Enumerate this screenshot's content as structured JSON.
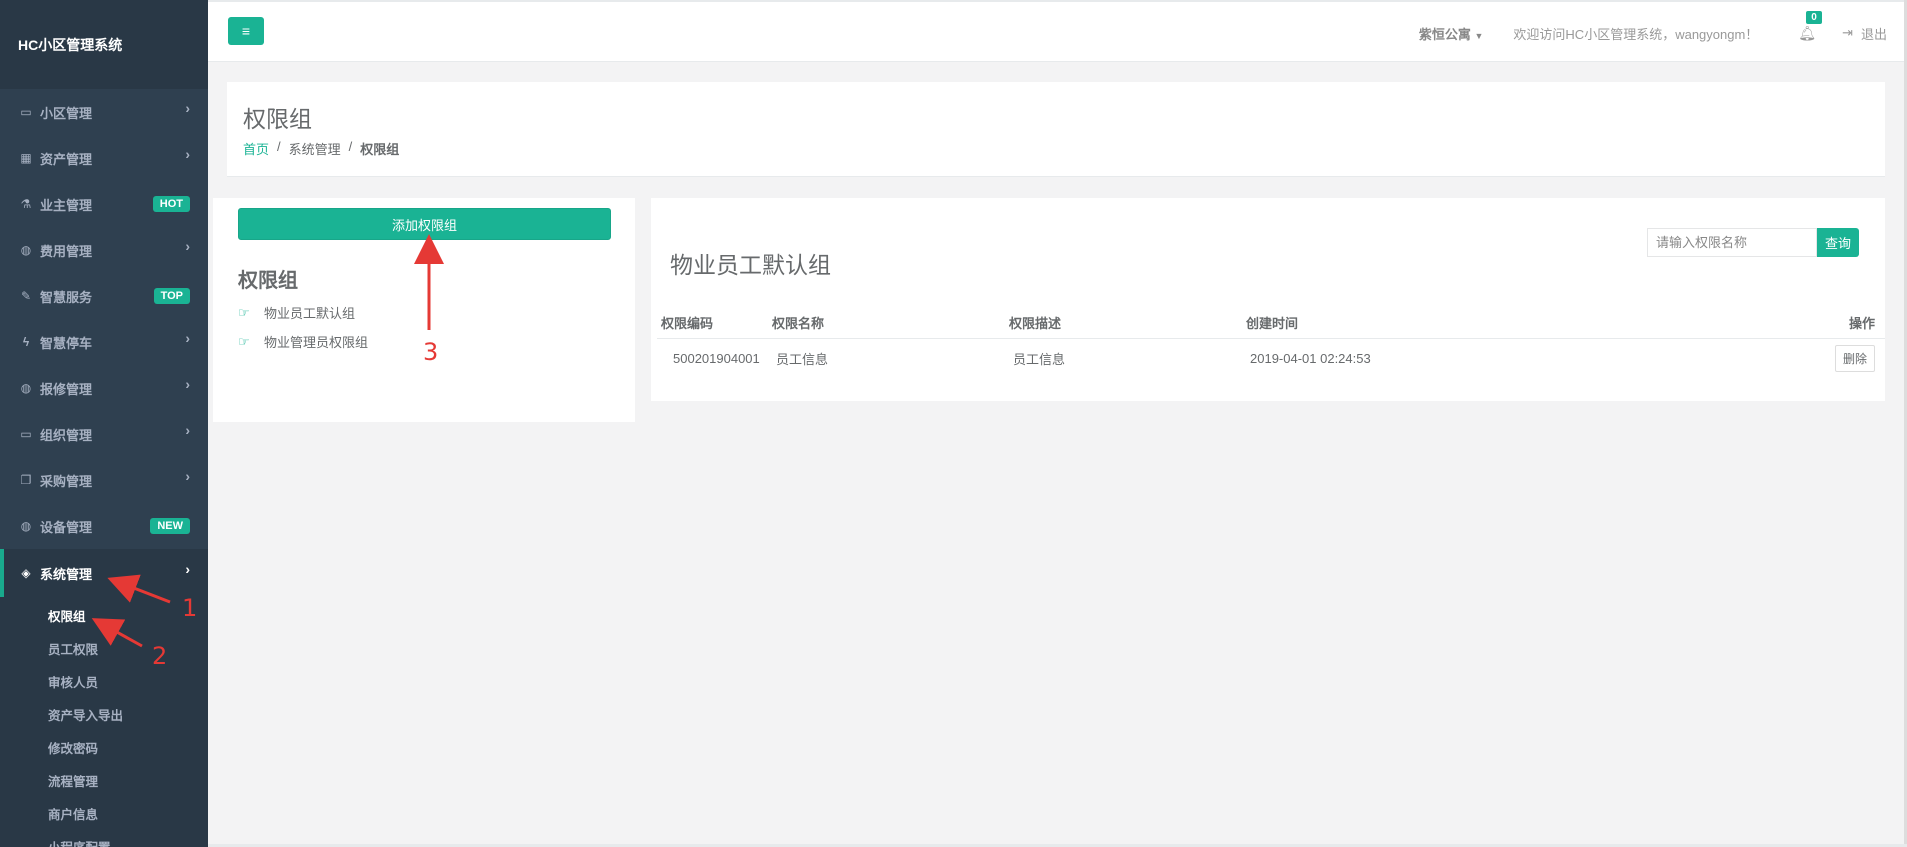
{
  "brand": "HC小区管理系统",
  "sidebar": {
    "items": [
      {
        "label": "小区管理",
        "icon": "laptop-icon",
        "glyph": "▭"
      },
      {
        "label": "资产管理",
        "icon": "grid-icon",
        "glyph": "▦"
      },
      {
        "label": "业主管理",
        "icon": "flask-icon",
        "glyph": "⚗",
        "badge": "HOT"
      },
      {
        "label": "费用管理",
        "icon": "globe-icon",
        "glyph": "◍"
      },
      {
        "label": "智慧服务",
        "icon": "edit-icon",
        "glyph": "✎",
        "badge": "TOP"
      },
      {
        "label": "智慧停车",
        "icon": "bolt-icon",
        "glyph": "ϟ"
      },
      {
        "label": "报修管理",
        "icon": "globe-icon",
        "glyph": "◍"
      },
      {
        "label": "组织管理",
        "icon": "desktop-icon",
        "glyph": "▭"
      },
      {
        "label": "采购管理",
        "icon": "copy-icon",
        "glyph": "❐"
      },
      {
        "label": "设备管理",
        "icon": "globe-icon",
        "glyph": "◍",
        "badge": "NEW"
      },
      {
        "label": "系统管理",
        "icon": "diamond-icon",
        "glyph": "◈"
      }
    ],
    "submenu": [
      "权限组",
      "员工权限",
      "审核人员",
      "资产导入导出",
      "修改密码",
      "流程管理",
      "商户信息",
      "小程序配置"
    ]
  },
  "topbar": {
    "menu_glyph": "≡",
    "community": "紫恒公寓",
    "welcome": "欢迎访问HC小区管理系统，wangyongm！",
    "notification_count": "0",
    "logout": "退出"
  },
  "heading": {
    "title": "权限组",
    "breadcrumb": [
      "首页",
      "系统管理",
      "权限组"
    ]
  },
  "left_panel": {
    "add_button": "添加权限组",
    "title": "权限组",
    "groups": [
      "物业员工默认组",
      "物业管理员权限组"
    ]
  },
  "right_panel": {
    "title": "物业员工默认组",
    "search_placeholder": "请输入权限名称",
    "search_button": "查询",
    "columns": [
      "权限编码",
      "权限名称",
      "权限描述",
      "创建时间",
      "操作"
    ],
    "rows": [
      {
        "code": "500201904001",
        "name": "员工信息",
        "desc": "员工信息",
        "created": "2019-04-01 02:24:53",
        "action": "删除"
      }
    ]
  },
  "annotations": [
    "1",
    "2",
    "3"
  ],
  "colors": {
    "accent": "#1ab394",
    "sidebar": "#2f4050",
    "annotation": "#e53935"
  }
}
